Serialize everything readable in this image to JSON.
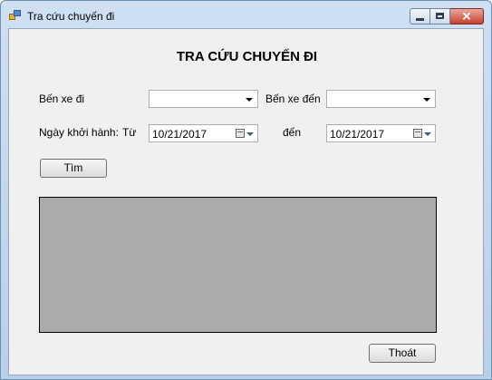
{
  "window": {
    "title": "Tra cứu chuyến đi"
  },
  "form": {
    "heading": "TRA CỨU CHUYẾN ĐI",
    "departure_label": "Bến xe đi",
    "departure_value": "",
    "arrival_label": "Bến xe đến",
    "arrival_value": "",
    "date_label": "Ngày khởi hành:",
    "from_label": "Từ",
    "from_date": "10/21/2017",
    "to_label": "đến",
    "to_date": "10/21/2017",
    "search_button": "Tìm",
    "exit_button": "Thoát"
  },
  "icons": {
    "app": "app-icon",
    "minimize": "minimize-icon",
    "maximize": "maximize-icon",
    "close": "close-icon",
    "calendar": "calendar-icon",
    "dropdown": "chevron-down-icon"
  }
}
